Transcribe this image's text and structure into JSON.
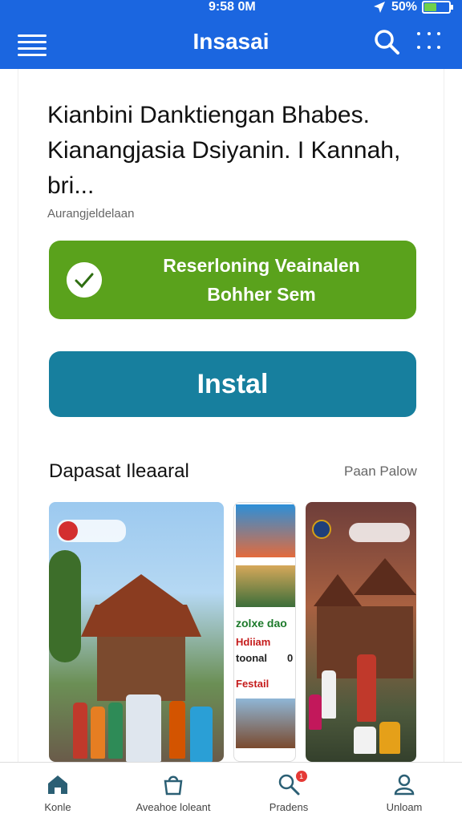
{
  "status": {
    "time": "9:58 0M",
    "battery": "50%",
    "battery_level": 0.5
  },
  "app_bar": {
    "title": "Insasai"
  },
  "headline": "Kianbini Danktiengan Bhabes. Kianangjasia Dsiyanin. I Kannah, bri...",
  "subtitle": "Aurangjeldelaan",
  "verify_button": {
    "line1": "Reserloning Veainalen",
    "line2": "Bohher Sem"
  },
  "install_button": {
    "label": "Instal"
  },
  "section": {
    "title": "Dapasat Ileaaral",
    "link": "Paan Palow"
  },
  "screenshots": {
    "middle_lines": [
      "zolxe dao",
      "Hdiiam",
      "toonal",
      "Festail"
    ],
    "middle_marker": "0"
  },
  "bottom_nav": [
    {
      "label": "Konle",
      "icon": "home-icon"
    },
    {
      "label": "Aveahoe loleant",
      "icon": "shopping-bag-icon"
    },
    {
      "label": "Pradens",
      "icon": "search-icon",
      "badge": "1"
    },
    {
      "label": "Unloam",
      "icon": "user-icon"
    }
  ],
  "colors": {
    "primary": "#1b66e0",
    "verify": "#5aa21c",
    "install": "#177f9e"
  }
}
